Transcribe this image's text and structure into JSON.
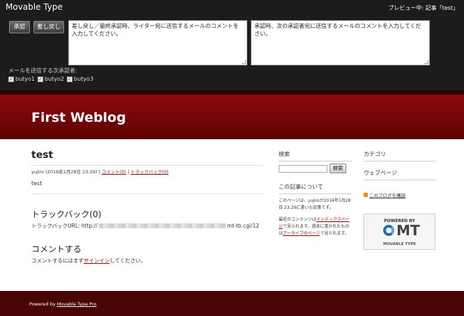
{
  "preview_bar": {
    "brand": "Movable Type",
    "preview_label": "プレビュー中: 記事「test」",
    "approve_label": "承認",
    "reject_label": "差し戻し",
    "reject_comment": "差し戻し／最終承認時、ライター宛に送信するメールのコメントを入力してください。",
    "approve_comment": "承認時、次の承認者宛に送信するメールのコメントを入力してください。",
    "recipients_label": "メールを送信する次承認者:",
    "recipients": [
      "butyo1",
      "butyo2",
      "butyo3"
    ]
  },
  "blog": {
    "title": "First Weblog"
  },
  "entry": {
    "title": "test",
    "author_date": "yujiro (2016年1月28日 23:29)",
    "sep": "|",
    "comments_link": "コメント(0)",
    "trackbacks_link": "トラックバック(0)",
    "body": "test"
  },
  "trackback": {
    "title": "トラックバック(0)",
    "url_label": "トラックバックURL: http://",
    "url_suffix": "mt-tb.cgi/12"
  },
  "comment": {
    "title": "コメントする",
    "text_before": "コメントするにはまず",
    "signin_link": "サインイン",
    "text_after": "してください。"
  },
  "sidebar": {
    "search_heading": "検索",
    "search_button": "検索",
    "about_heading": "この記事について",
    "about_text": "このページは、yujiroが2016年1月28日 23:29に書いた記事です。",
    "about_text2_a": "最近のコンテンツは",
    "about_link1": "インデックスページ",
    "about_text2_b": "で見られます。過去に書かれたものは",
    "about_link2": "アーカイブのページ",
    "about_text2_c": "で見られます。",
    "category_heading": "カテゴリ",
    "webpage_heading": "ウェブページ",
    "subscribe_link": "このブログを購読",
    "badge_powered": "POWERED BY",
    "badge_logo": "MT",
    "badge_sub": "MOVABLE TYPE"
  },
  "footer": {
    "powered_by": "Powered by ",
    "link": "Movable Type Pro"
  }
}
